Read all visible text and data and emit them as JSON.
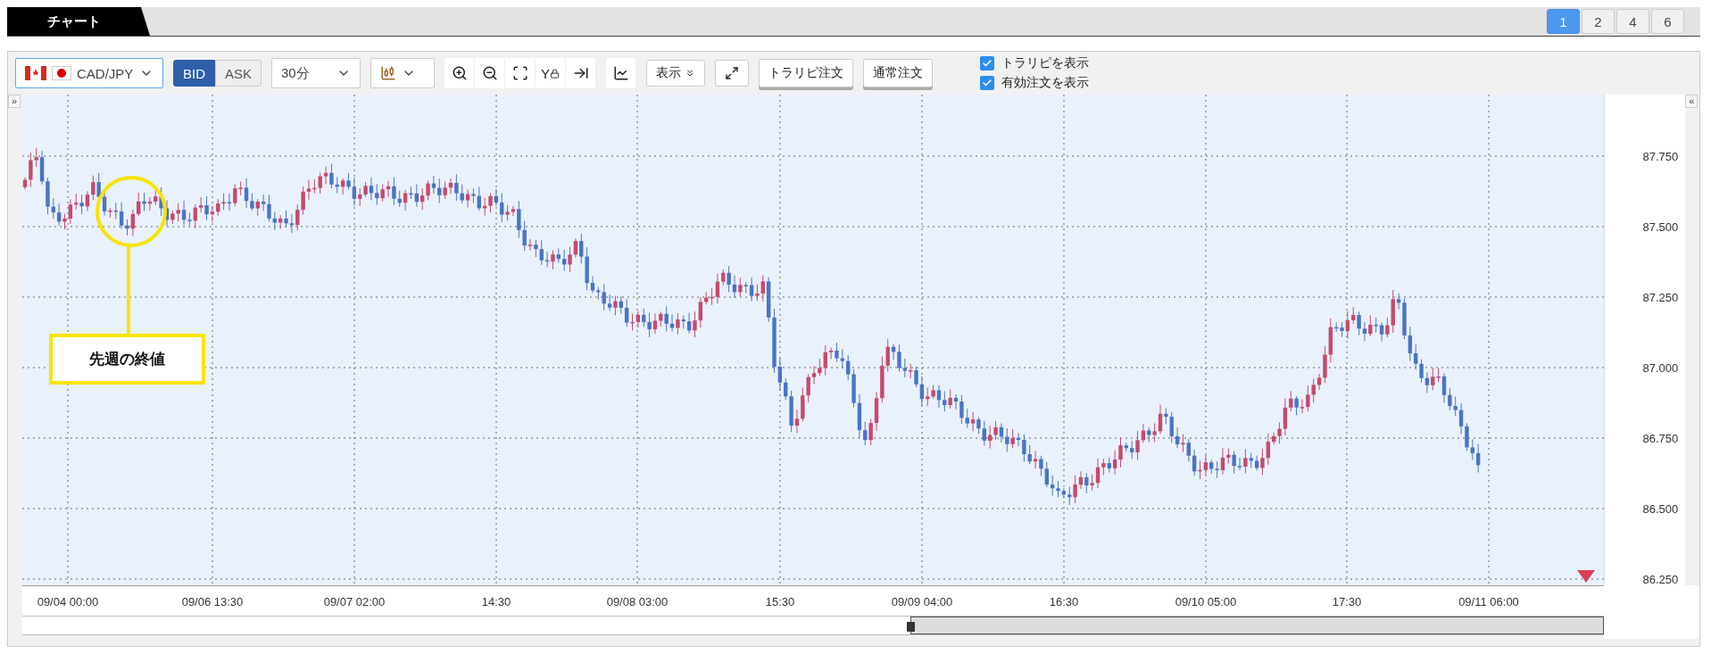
{
  "top_tab": {
    "label": "チャート"
  },
  "layout_buttons": [
    {
      "label": "1",
      "selected": true
    },
    {
      "label": "2",
      "selected": false
    },
    {
      "label": "4",
      "selected": false
    },
    {
      "label": "6",
      "selected": false
    }
  ],
  "toolbar": {
    "pair": "CAD/JPY",
    "price_sides": [
      {
        "label": "BID",
        "selected": true
      },
      {
        "label": "ASK",
        "selected": false
      }
    ],
    "timeframe": "30分",
    "y_lock_label": "Y",
    "display_button": "表示",
    "order_buttons": [
      "トラリピ注文",
      "通常注文"
    ],
    "checkboxes": [
      {
        "label": "トラリピを表示",
        "checked": true
      },
      {
        "label": "有効注文を表示",
        "checked": true
      }
    ]
  },
  "chart": {
    "left_toggle": "»",
    "right_toggle": "«",
    "annotation": "先週の終値",
    "y_axis_labels": [
      "87.750",
      "87.500",
      "87.250",
      "87.000",
      "86.750",
      "86.500",
      "86.250"
    ],
    "x_axis_labels": [
      "09/04 00:00",
      "09/06 13:30",
      "09/07 02:00",
      "14:30",
      "09/08 03:00",
      "15:30",
      "09/09 04:00",
      "16:30",
      "09/10 05:00",
      "17:30",
      "09/11 06:00"
    ]
  }
}
